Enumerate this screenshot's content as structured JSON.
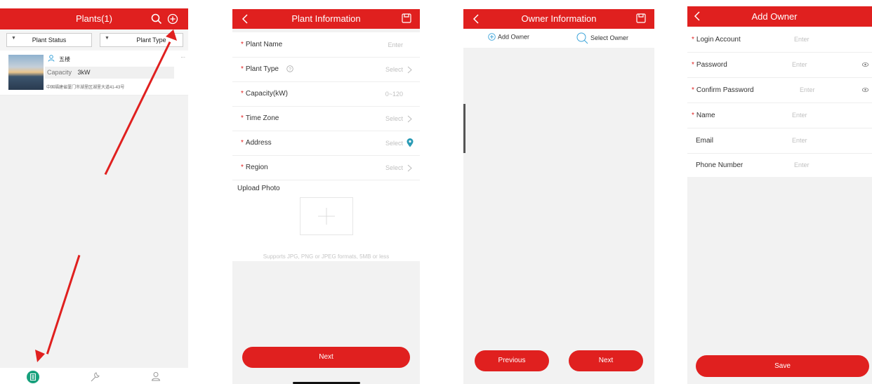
{
  "screen1": {
    "title": "Plants(1)",
    "filters": [
      "Plant Status",
      "Plant Type"
    ],
    "plant": {
      "name": "五楼",
      "capacity_label": "Capacity",
      "capacity_value": "3kW",
      "address": "中国福建省厦门市湖里区湖里大道41-43号",
      "more": "..."
    }
  },
  "screen2": {
    "title": "Plant Information",
    "fields": [
      {
        "label": "Plant Name",
        "value": "Enter"
      },
      {
        "label": "Plant Type",
        "value": "Select"
      },
      {
        "label": "Capacity(kW)",
        "value": "0~120"
      },
      {
        "label": "Time Zone",
        "value": "Select"
      },
      {
        "label": "Address",
        "value": "Select"
      },
      {
        "label": "Region",
        "value": "Select"
      }
    ],
    "upload_label": "Upload Photo",
    "upload_hint": "Supports JPG, PNG or JPEG formats, 5MB or less",
    "next": "Next"
  },
  "screen3": {
    "title": "Owner Information",
    "add_owner": "Add Owner",
    "select_owner": "Select Owner",
    "previous": "Previous",
    "next": "Next"
  },
  "screen4": {
    "title": "Add Owner",
    "fields": [
      {
        "label": "Login Account",
        "value": "Enter"
      },
      {
        "label": "Password",
        "value": "Enter"
      },
      {
        "label": "Confirm Password",
        "value": "Enter"
      },
      {
        "label": "Name",
        "value": "Enter"
      },
      {
        "label": "Email",
        "value": "Enter"
      },
      {
        "label": "Phone Number",
        "value": "Enter"
      }
    ],
    "save": "Save"
  },
  "colors": {
    "accent": "#e0201f",
    "tab_active": "#17a07c"
  }
}
